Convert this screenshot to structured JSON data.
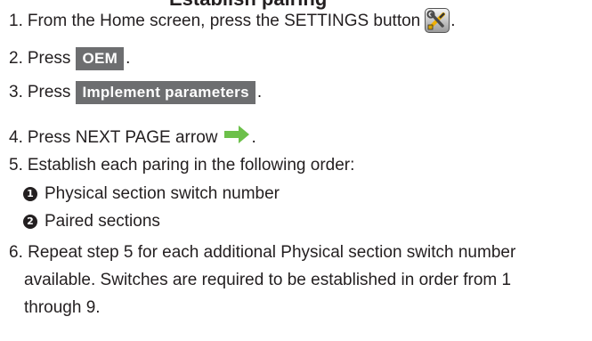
{
  "heading_fragment": "Establish pairing",
  "steps": {
    "s1": {
      "num": "1.",
      "text": "From the Home screen, press the SETTINGS button",
      "end": "."
    },
    "s2": {
      "num": "2.",
      "text": "Press",
      "button": "OEM",
      "end": "."
    },
    "s3": {
      "num": "3.",
      "text": "Press",
      "button": "Implement parameters",
      "end": "."
    },
    "s4": {
      "num": "4.",
      "text": "Press NEXT PAGE arrow",
      "end": "."
    },
    "s5": {
      "num": "5.",
      "text": "Establish each paring in the following order:",
      "sub": [
        {
          "marker": "1",
          "text": "Physical section switch number"
        },
        {
          "marker": "2",
          "text": "Paired sections"
        }
      ]
    },
    "s6": {
      "num": "6.",
      "line1": "Repeat step 5 for each additional Physical section switch number",
      "line2": "available. Switches are required to be established in order from 1",
      "line3": "through 9."
    }
  },
  "icons": {
    "settings": "settings-tools-icon",
    "next_page": "green-right-arrow-icon"
  },
  "colors": {
    "button_bg": "#6d6e70",
    "arrow_green": "#6cc04a",
    "text": "#231f20"
  }
}
